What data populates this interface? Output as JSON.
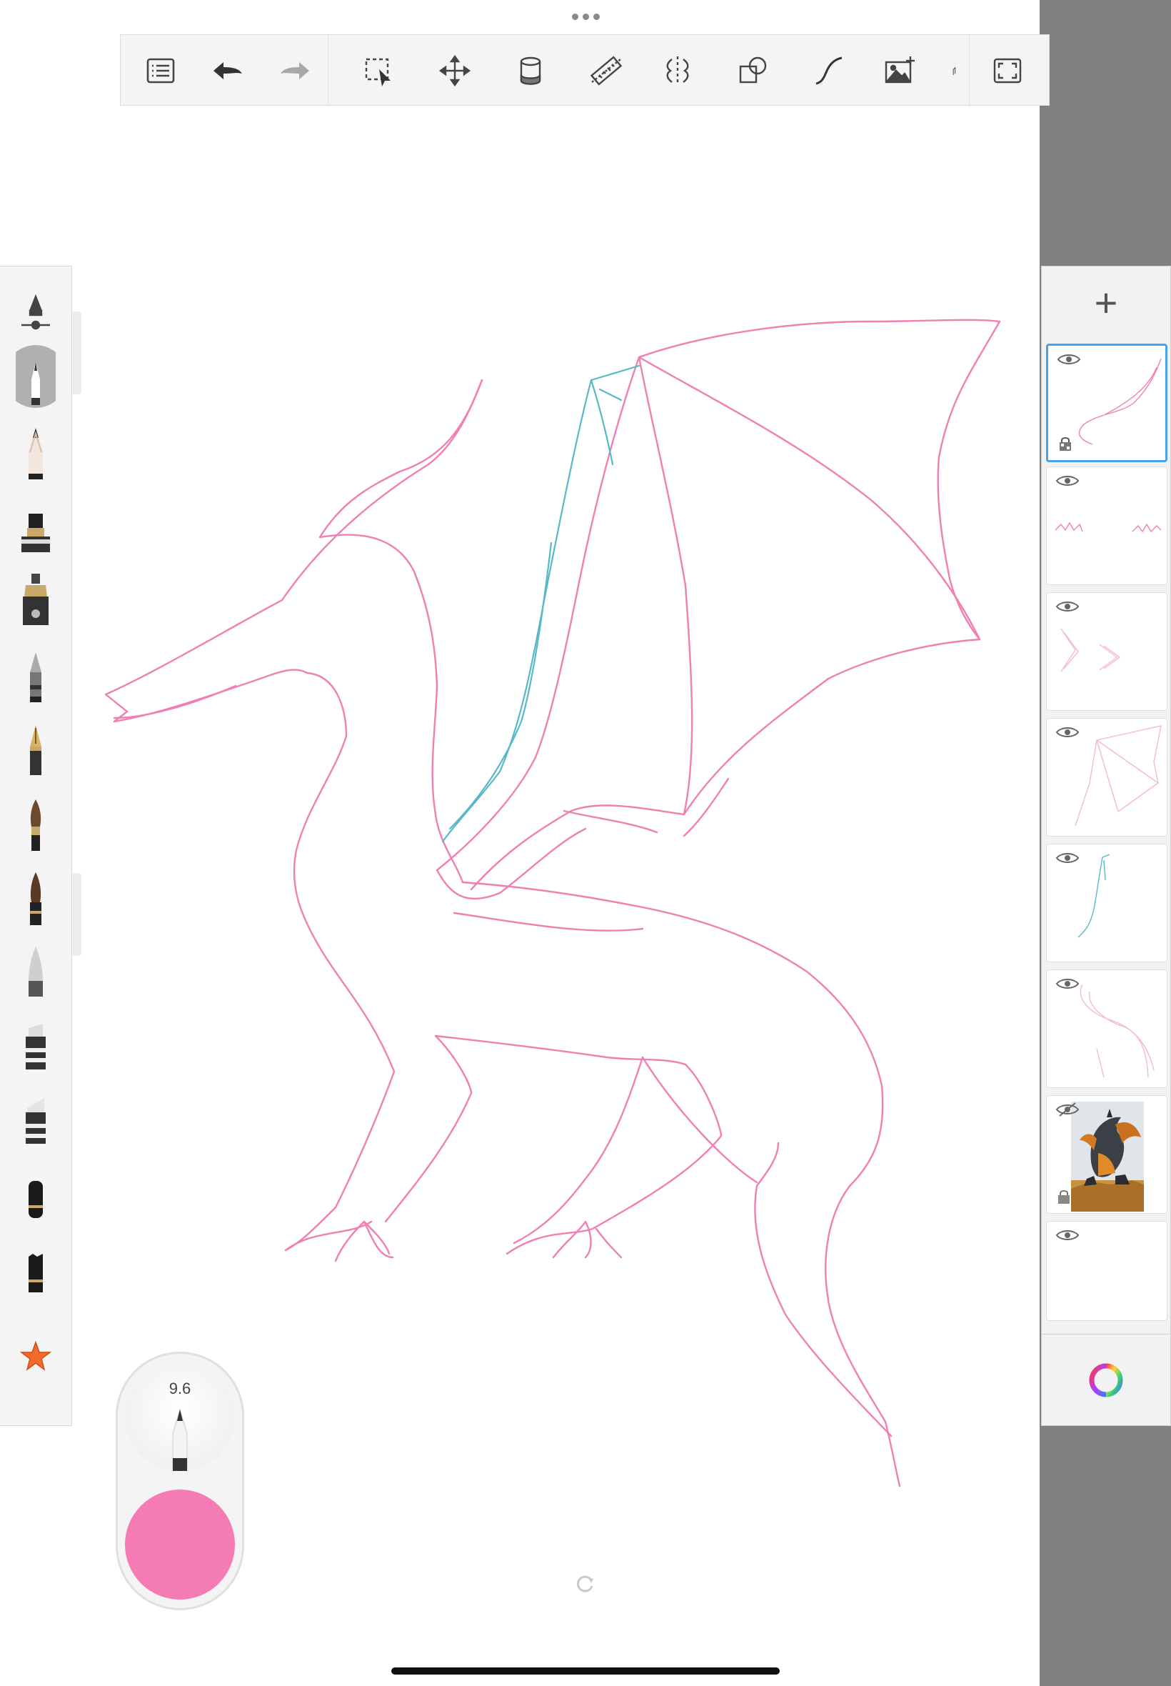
{
  "toolbar": {
    "tools": [
      "list-icon",
      "undo-icon",
      "redo-icon",
      "selection-icon",
      "move-icon",
      "fill-icon",
      "ruler-icon",
      "symmetry-icon",
      "shapes-icon",
      "curve-icon",
      "add-image-icon",
      "fullscreen-icon"
    ]
  },
  "brush_palette": {
    "brushes": [
      "brush-properties-icon",
      "pencil-selected-icon",
      "pencil-icon",
      "marker-icon",
      "ink-pen-icon",
      "ballpoint-icon",
      "fountain-pen-icon",
      "paint-brush-icon",
      "ink-brush-icon",
      "airbrush-icon",
      "chisel-marker-icon",
      "wide-marker-icon",
      "eraser-icon",
      "soft-eraser-icon",
      "favorites-star-icon"
    ]
  },
  "brush_widget": {
    "size_value": "9.6",
    "color": "#f47bb4"
  },
  "layers": {
    "add_label": "+",
    "items": [
      "head-neck-layer",
      "claws-layer",
      "chevrons-layer",
      "wing-layer",
      "blue-guide-layer",
      "body-layer",
      "reference-image-layer",
      "blank-layer"
    ]
  },
  "colors": {
    "stroke_pink": "#f07fb2",
    "stroke_blue": "#58b8c8",
    "accent": "#4aa3e8",
    "panel_gray": "#808080"
  }
}
